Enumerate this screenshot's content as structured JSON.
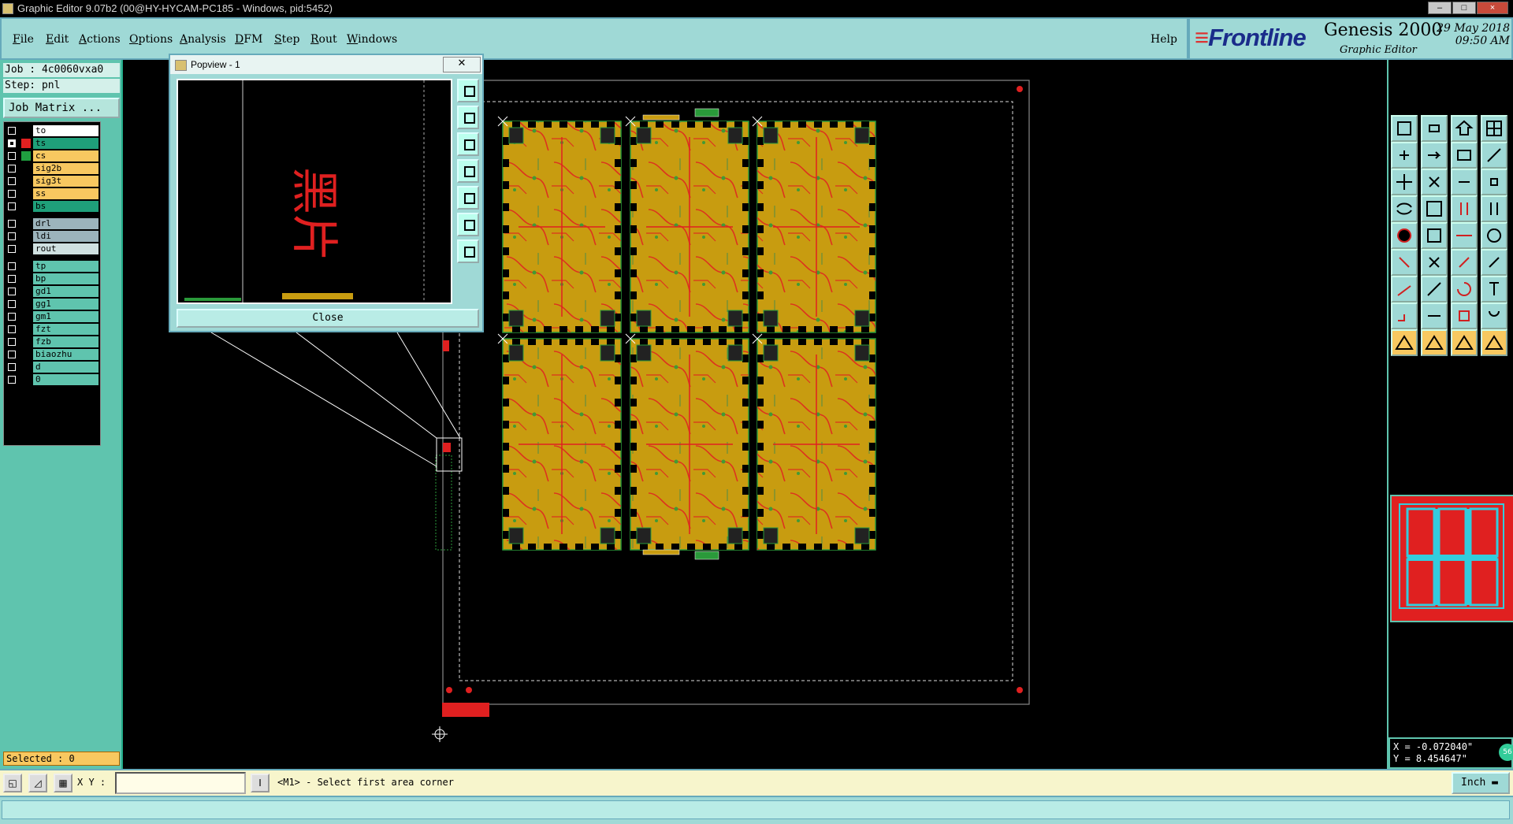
{
  "window": {
    "title": "Graphic Editor 9.07b2 (00@HY-HYCAM-PC185 - Windows, pid:5452)",
    "controls": [
      "–",
      "□",
      "×"
    ]
  },
  "menubar": {
    "items": [
      {
        "label": "File",
        "key": "F"
      },
      {
        "label": "Edit",
        "key": "E"
      },
      {
        "label": "Actions",
        "key": "A"
      },
      {
        "label": "Options",
        "key": "O"
      },
      {
        "label": "Analysis",
        "key": "A"
      },
      {
        "label": "DFM",
        "key": "D"
      },
      {
        "label": "Step",
        "key": "S"
      },
      {
        "label": "Rout",
        "key": "R"
      },
      {
        "label": "Windows",
        "key": "W"
      }
    ],
    "help": "Help"
  },
  "brand": {
    "logo": "Frontline",
    "product": "Genesis 2000",
    "subtitle": "Graphic Editor",
    "date": "29 May 2018",
    "time": "09:50 AM"
  },
  "job": {
    "job_line": "Job : 4c0060vxa0",
    "step_line": "Step: pnl",
    "matrix_button": "Job Matrix ..."
  },
  "layers": [
    {
      "name": "to",
      "bg": "#ffffff",
      "sw": "#000000",
      "checked": false
    },
    {
      "name": "ts",
      "bg": "#1fa07a",
      "sw": "#e02020",
      "checked": true
    },
    {
      "name": "cs",
      "bg": "#f8c860",
      "sw": "#20a040",
      "checked": false
    },
    {
      "name": "sig2b",
      "bg": "#f8c860",
      "sw": "#000000",
      "checked": false
    },
    {
      "name": "sig3t",
      "bg": "#f8c860",
      "sw": "#000000",
      "checked": false
    },
    {
      "name": "ss",
      "bg": "#f8c860",
      "sw": "#000000",
      "checked": false
    },
    {
      "name": "bs",
      "bg": "#1fa07a",
      "sw": "#000000",
      "checked": false
    },
    {
      "name": "drl",
      "bg": "#9cb4bc",
      "sw": "#000000",
      "checked": false,
      "gap": true
    },
    {
      "name": "ldi",
      "bg": "#9cb4bc",
      "sw": "#000000",
      "checked": false
    },
    {
      "name": "rout",
      "bg": "#cfe0e0",
      "sw": "#000000",
      "checked": false
    },
    {
      "name": "tp",
      "bg": "#5fc4ae",
      "sw": "#000000",
      "checked": false,
      "gap": true
    },
    {
      "name": "bp",
      "bg": "#5fc4ae",
      "sw": "#000000",
      "checked": false
    },
    {
      "name": "gd1",
      "bg": "#5fc4ae",
      "sw": "#000000",
      "checked": false
    },
    {
      "name": "gg1",
      "bg": "#5fc4ae",
      "sw": "#000000",
      "checked": false
    },
    {
      "name": "gm1",
      "bg": "#5fc4ae",
      "sw": "#000000",
      "checked": false
    },
    {
      "name": "fzt",
      "bg": "#5fc4ae",
      "sw": "#000000",
      "checked": false
    },
    {
      "name": "fzb",
      "bg": "#5fc4ae",
      "sw": "#000000",
      "checked": false
    },
    {
      "name": "biaozhu",
      "bg": "#5fc4ae",
      "sw": "#000000",
      "checked": false
    },
    {
      "name": "d",
      "bg": "#5fc4ae",
      "sw": "#000000",
      "checked": false
    },
    {
      "name": "0",
      "bg": "#5fc4ae",
      "sw": "#000000",
      "checked": false
    }
  ],
  "selected_text": "Selected : 0",
  "popview": {
    "title": "Popview - 1",
    "close_label": "Close",
    "glyphs": "黑片"
  },
  "coords": {
    "x": "X = -0.072040\"",
    "y": "Y = 8.454647\"",
    "badge": "56"
  },
  "cmdbar": {
    "xy_label": "X Y :",
    "xy_value": "",
    "message": "<M1> - Select first area corner",
    "unit": "Inch"
  },
  "colors": {
    "panel": "#9fd9d6",
    "board": "#c89c10",
    "trace": "#e02020"
  }
}
